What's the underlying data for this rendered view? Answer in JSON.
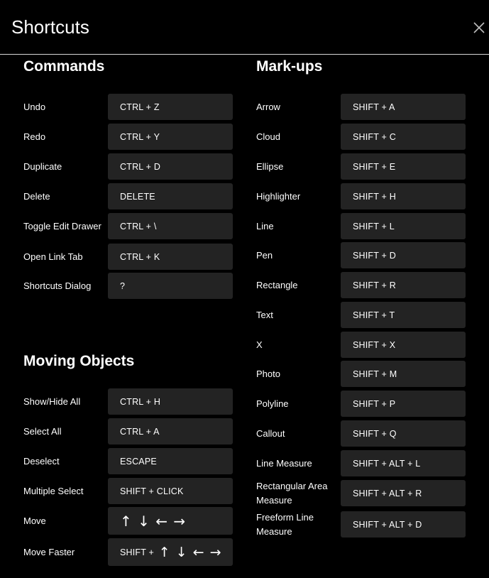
{
  "dialog": {
    "title": "Shortcuts",
    "close_label": "×"
  },
  "commands": {
    "title": "Commands",
    "items": [
      {
        "label": "Undo",
        "key": "CTRL + Z"
      },
      {
        "label": "Redo",
        "key": "CTRL + Y"
      },
      {
        "label": "Duplicate",
        "key": "CTRL + D"
      },
      {
        "label": "Delete",
        "key": "DELETE"
      },
      {
        "label": "Toggle Edit Drawer",
        "key": "CTRL + \\"
      },
      {
        "label": "Open Link Tab",
        "key": "CTRL + K"
      },
      {
        "label": "Shortcuts Dialog",
        "key": "?"
      }
    ]
  },
  "moving": {
    "title": "Moving Objects",
    "items": [
      {
        "label": "Show/Hide All",
        "key": "CTRL + H"
      },
      {
        "label": "Select All",
        "key": "CTRL + A"
      },
      {
        "label": "Deselect",
        "key": "ESCAPE"
      },
      {
        "label": "Multiple Select",
        "key": "SHIFT + CLICK"
      },
      {
        "label": "Move",
        "key": "↑ ↓ ← →"
      },
      {
        "label": "Move Faster",
        "key_prefix": "SHIFT + ",
        "key_arrows": "↑ ↓ ← →"
      }
    ]
  },
  "markups": {
    "title": "Mark-ups",
    "items": [
      {
        "label": "Arrow",
        "key": "SHIFT + A"
      },
      {
        "label": "Cloud",
        "key": "SHIFT + C"
      },
      {
        "label": "Ellipse",
        "key": "SHIFT + E"
      },
      {
        "label": "Highlighter",
        "key": "SHIFT + H"
      },
      {
        "label": "Line",
        "key": "SHIFT + L"
      },
      {
        "label": "Pen",
        "key": "SHIFT + D"
      },
      {
        "label": "Rectangle",
        "key": "SHIFT + R"
      },
      {
        "label": "Text",
        "key": "SHIFT + T"
      },
      {
        "label": "X",
        "key": "SHIFT + X"
      },
      {
        "label": "Photo",
        "key": "SHIFT + M"
      },
      {
        "label": "Polyline",
        "key": "SHIFT + P"
      },
      {
        "label": "Callout",
        "key": "SHIFT + Q"
      },
      {
        "label": "Line Measure",
        "key": "SHIFT + ALT + L"
      },
      {
        "label": "Rectangular Area Measure",
        "key": "SHIFT + ALT + R"
      },
      {
        "label": "Freeform Line Measure",
        "key": "SHIFT + ALT + D"
      }
    ]
  },
  "colors": {
    "background": "#000000",
    "key_background": "#232323",
    "text": "#ffffff",
    "divider": "#d8d8d8"
  }
}
